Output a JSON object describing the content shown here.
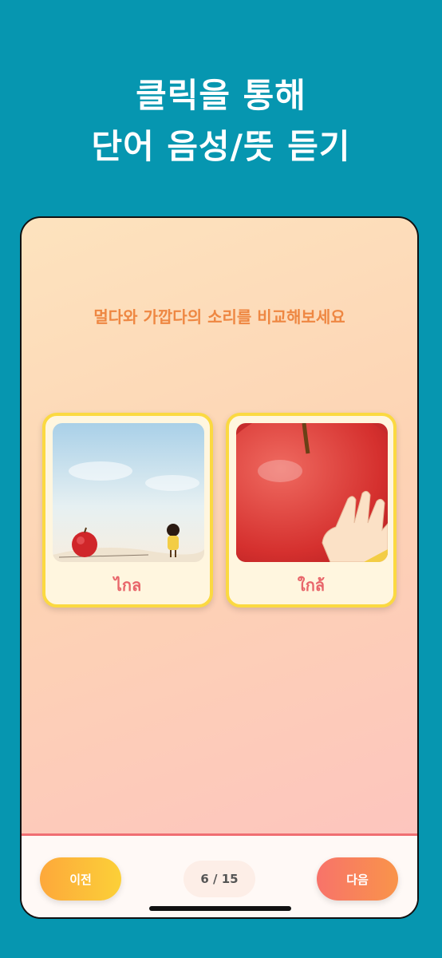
{
  "headline": {
    "line1": "클릭을 통해",
    "line2": "단어 음성/뜻 듣기"
  },
  "lesson": {
    "prompt": "멀다와 가깝다의 소리를 비교해보세요",
    "cards": [
      {
        "word": "ไกล",
        "image": "far-apple-illustration"
      },
      {
        "word": "ใกล้",
        "image": "near-apple-illustration"
      }
    ]
  },
  "navigation": {
    "prev_label": "이전",
    "next_label": "다음",
    "counter": "6 / 15"
  },
  "colors": {
    "background": "#0696b0",
    "prompt": "#ee8742",
    "card_border": "#fbd941",
    "word": "#e8656a"
  }
}
